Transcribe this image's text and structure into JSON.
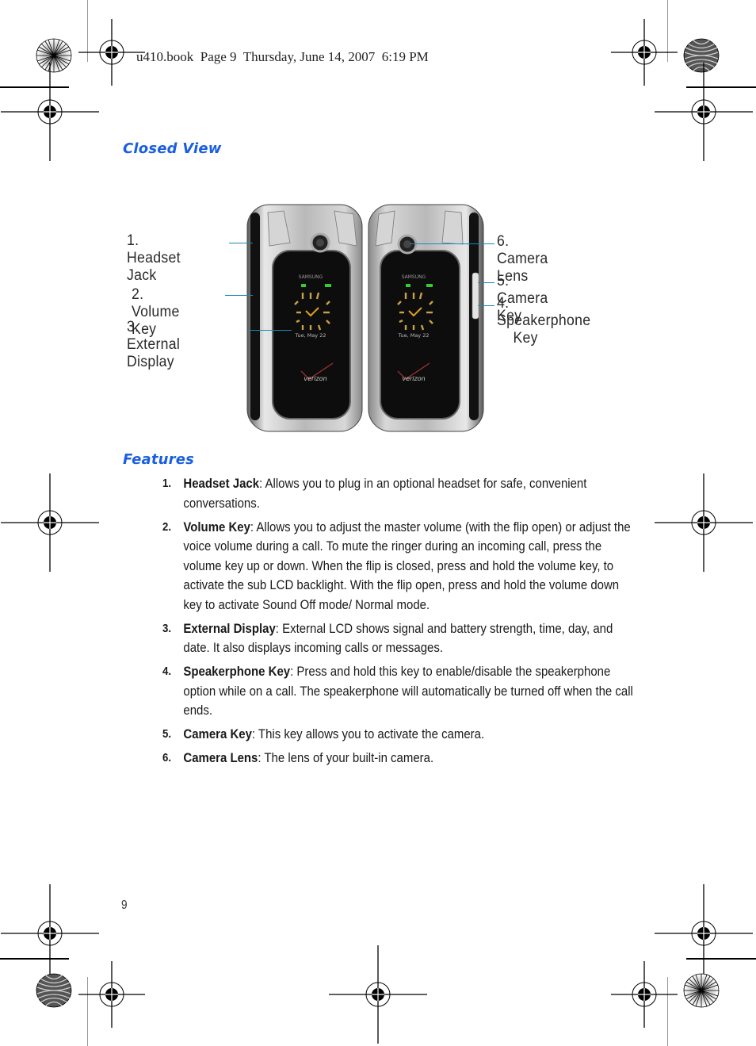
{
  "header": {
    "print_stamp": "u410.book  Page 9  Thursday, June 14, 2007  6:19 PM"
  },
  "sections": {
    "closed_view_title": "Closed View",
    "features_title": "Features"
  },
  "figure": {
    "callouts_left": [
      {
        "label": "1. Headset Jack"
      },
      {
        "label": "2. Volume Key"
      },
      {
        "label": "3. External Display"
      }
    ],
    "callouts_right": [
      {
        "label": "6. Camera Lens"
      },
      {
        "label": "5. Camera Key"
      },
      {
        "label": "4. Speakerphone",
        "label_line2": "Key"
      }
    ],
    "phone_brand": "SAMSUNG",
    "carrier_logo": "verizon",
    "display_date": "Tue, May 22",
    "callout_line_color": "#1d86b8"
  },
  "features": [
    {
      "num": "1.",
      "term": "Headset Jack",
      "desc": ": Allows you to plug in an optional headset for safe, convenient conversations."
    },
    {
      "num": "2.",
      "term": "Volume Key",
      "desc": ": Allows you to adjust the master volume (with the flip open) or adjust the voice volume during a call. To mute the ringer during an incoming call, press the volume key up or down. When the flip is closed, press and hold the volume key, to activate the sub LCD backlight. With the flip open, press and hold the volume down key to activate Sound Off mode/ Normal mode."
    },
    {
      "num": "3.",
      "term": "External Display",
      "desc": ": External LCD shows signal and battery strength, time, day, and date. It also displays incoming calls or messages."
    },
    {
      "num": "4.",
      "term": "Speakerphone Key",
      "desc": ": Press and hold this key to enable/disable the speakerphone option while on a call. The speakerphone will automatically be turned off when the call ends."
    },
    {
      "num": "5.",
      "term": "Camera Key",
      "desc": ": This key allows you to activate the camera."
    },
    {
      "num": "6.",
      "term": "Camera Lens",
      "desc": ": The lens of your built-in camera."
    }
  ],
  "footer": {
    "page_number": "9"
  },
  "colors": {
    "heading_blue": "#1a5fe0"
  }
}
